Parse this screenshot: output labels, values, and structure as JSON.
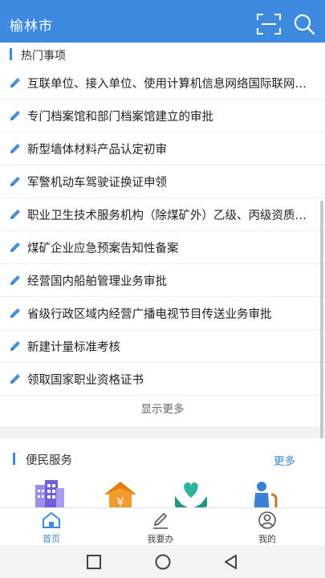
{
  "header": {
    "title": "榆林市",
    "scan_icon": "scan-icon",
    "search_icon": "search-icon"
  },
  "hot": {
    "heading": "热门事项",
    "items": [
      "互联单位、接入单位、使用计算机信息网络国际联网的单位备案",
      "专门档案馆和部门档案馆建立的审批",
      "新型墙体材料产品认定初审",
      "军警机动车驾驶证换证申领",
      "职业卫生技术服务机构（除煤矿外）乙级、丙级资质认可",
      "煤矿企业应急预案告知性备案",
      "经营国内船舶管理业务审批",
      "省级行政区域内经营广播电视节目传送业务审批",
      "新建计量标准考核",
      "领取国家职业资格证书"
    ],
    "show_more": "显示更多"
  },
  "service": {
    "heading": "便民服务",
    "more": "更多",
    "icons": [
      "building-icon",
      "finance-house-icon",
      "care-hands-icon",
      "elderly-icon"
    ]
  },
  "tabs": [
    {
      "label": "首页",
      "icon": "home-icon",
      "active": true
    },
    {
      "label": "我要办",
      "icon": "pen-icon",
      "active": false
    },
    {
      "label": "我的",
      "icon": "user-icon",
      "active": false
    }
  ],
  "colors": {
    "brand": "#3d8ae0",
    "pencil": "#4a90d9"
  }
}
